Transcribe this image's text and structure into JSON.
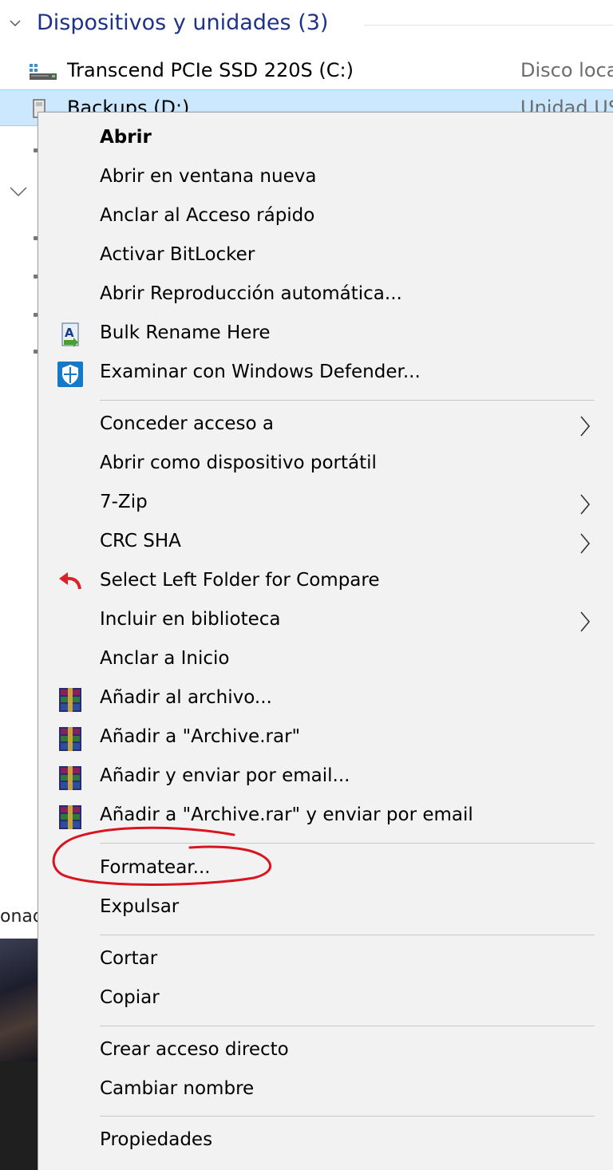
{
  "explorer": {
    "section_title": "Dispositivos y unidades (3)",
    "drives": [
      {
        "name": "Transcend PCIe SSD 220S (C:)",
        "type": "Disco loca"
      },
      {
        "name": "Backups (D:)",
        "type": "Unidad US"
      }
    ],
    "cut_text": "onad"
  },
  "context_menu": {
    "groups": [
      [
        {
          "label": "Abrir",
          "bold": true
        },
        {
          "label": "Abrir en ventana nueva"
        },
        {
          "label": "Anclar al Acceso rápido"
        },
        {
          "label": "Activar BitLocker"
        },
        {
          "label": "Abrir Reproducción automática..."
        },
        {
          "label": "Bulk Rename Here",
          "icon": "bulk-rename-icon"
        },
        {
          "label": "Examinar con Windows Defender...",
          "icon": "windows-defender-icon"
        }
      ],
      [
        {
          "label": "Conceder acceso a",
          "submenu": true
        },
        {
          "label": "Abrir como dispositivo portátil"
        },
        {
          "label": "7-Zip",
          "submenu": true
        },
        {
          "label": "CRC SHA",
          "submenu": true
        },
        {
          "label": "Select Left Folder for Compare",
          "icon": "compare-undo-icon"
        },
        {
          "label": "Incluir en biblioteca",
          "submenu": true
        },
        {
          "label": "Anclar a Inicio"
        },
        {
          "label": "Añadir al archivo...",
          "icon": "winrar-icon"
        },
        {
          "label": "Añadir a \"Archive.rar\"",
          "icon": "winrar-icon"
        },
        {
          "label": "Añadir y enviar por email...",
          "icon": "winrar-icon"
        },
        {
          "label": "Añadir a \"Archive.rar\" y enviar por email",
          "icon": "winrar-icon"
        }
      ],
      [
        {
          "label": "Formatear...",
          "highlighted_by_annotation": true
        },
        {
          "label": "Expulsar"
        }
      ],
      [
        {
          "label": "Cortar"
        },
        {
          "label": "Copiar"
        }
      ],
      [
        {
          "label": "Crear acceso directo"
        },
        {
          "label": "Cambiar nombre"
        }
      ],
      [
        {
          "label": "Propiedades"
        }
      ]
    ]
  },
  "colors": {
    "menu_background": "#f2f2f2",
    "selection": "#cce8ff",
    "section_title": "#1e3287",
    "annotation_red": "#d9141f"
  }
}
